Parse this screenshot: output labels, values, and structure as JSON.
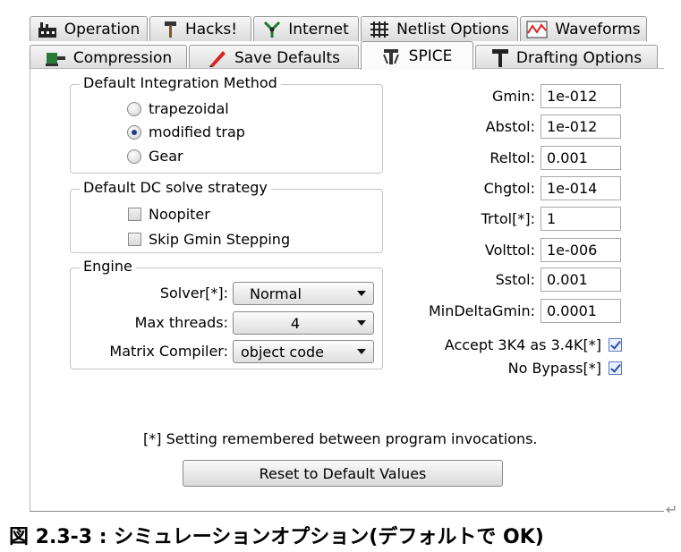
{
  "tabs_row1": [
    {
      "label": "Operation",
      "icon": "factory-icon"
    },
    {
      "label": "Hacks!",
      "icon": "hammer-icon"
    },
    {
      "label": "Internet",
      "icon": "network-icon"
    },
    {
      "label": "Netlist Options",
      "icon": "grid-icon"
    },
    {
      "label": "Waveforms",
      "icon": "waveform-icon"
    }
  ],
  "tabs_row2": [
    {
      "label": "Compression",
      "icon": "vise-icon"
    },
    {
      "label": "Save Defaults",
      "icon": "pencil-icon"
    },
    {
      "label": "SPICE",
      "icon": "spice-tools-icon",
      "active": true
    },
    {
      "label": "Drafting Options",
      "icon": "drafting-hammer-icon"
    }
  ],
  "integration": {
    "title": "Default Integration Method",
    "options": [
      "trapezoidal",
      "modified trap",
      "Gear"
    ],
    "selected": "modified trap"
  },
  "dc_solve": {
    "title": "Default DC solve strategy",
    "options": [
      {
        "label": "Noopiter",
        "checked": false
      },
      {
        "label": "Skip Gmin Stepping",
        "checked": false
      }
    ]
  },
  "engine": {
    "title": "Engine",
    "solver": {
      "label": "Solver[*]:",
      "value": "Normal"
    },
    "threads": {
      "label": "Max threads:",
      "value": "4"
    },
    "matrix": {
      "label": "Matrix Compiler:",
      "value": "object code"
    }
  },
  "params": [
    {
      "label": "Gmin:",
      "value": "1e-012"
    },
    {
      "label": "Abstol:",
      "value": "1e-012"
    },
    {
      "label": "Reltol:",
      "value": "0.001"
    },
    {
      "label": "Chgtol:",
      "value": "1e-014"
    },
    {
      "label": "Trtol[*]:",
      "value": "1"
    },
    {
      "label": "Volttol:",
      "value": "1e-006"
    },
    {
      "label": "Sstol:",
      "value": "0.001"
    },
    {
      "label": "MinDeltaGmin:",
      "value": "0.0001"
    }
  ],
  "checks": [
    {
      "label": "Accept 3K4 as 3.4K[*]",
      "checked": true
    },
    {
      "label": "No Bypass[*]",
      "checked": true
    }
  ],
  "note": "[*] Setting remembered between program invocations.",
  "reset_label": "Reset to Default Values",
  "caption": "図 2.3-3 : シミュレーションオプション(デフォルトで OK)",
  "colors": {
    "accent": "#1f3f8a",
    "border": "#9a9a9a"
  }
}
